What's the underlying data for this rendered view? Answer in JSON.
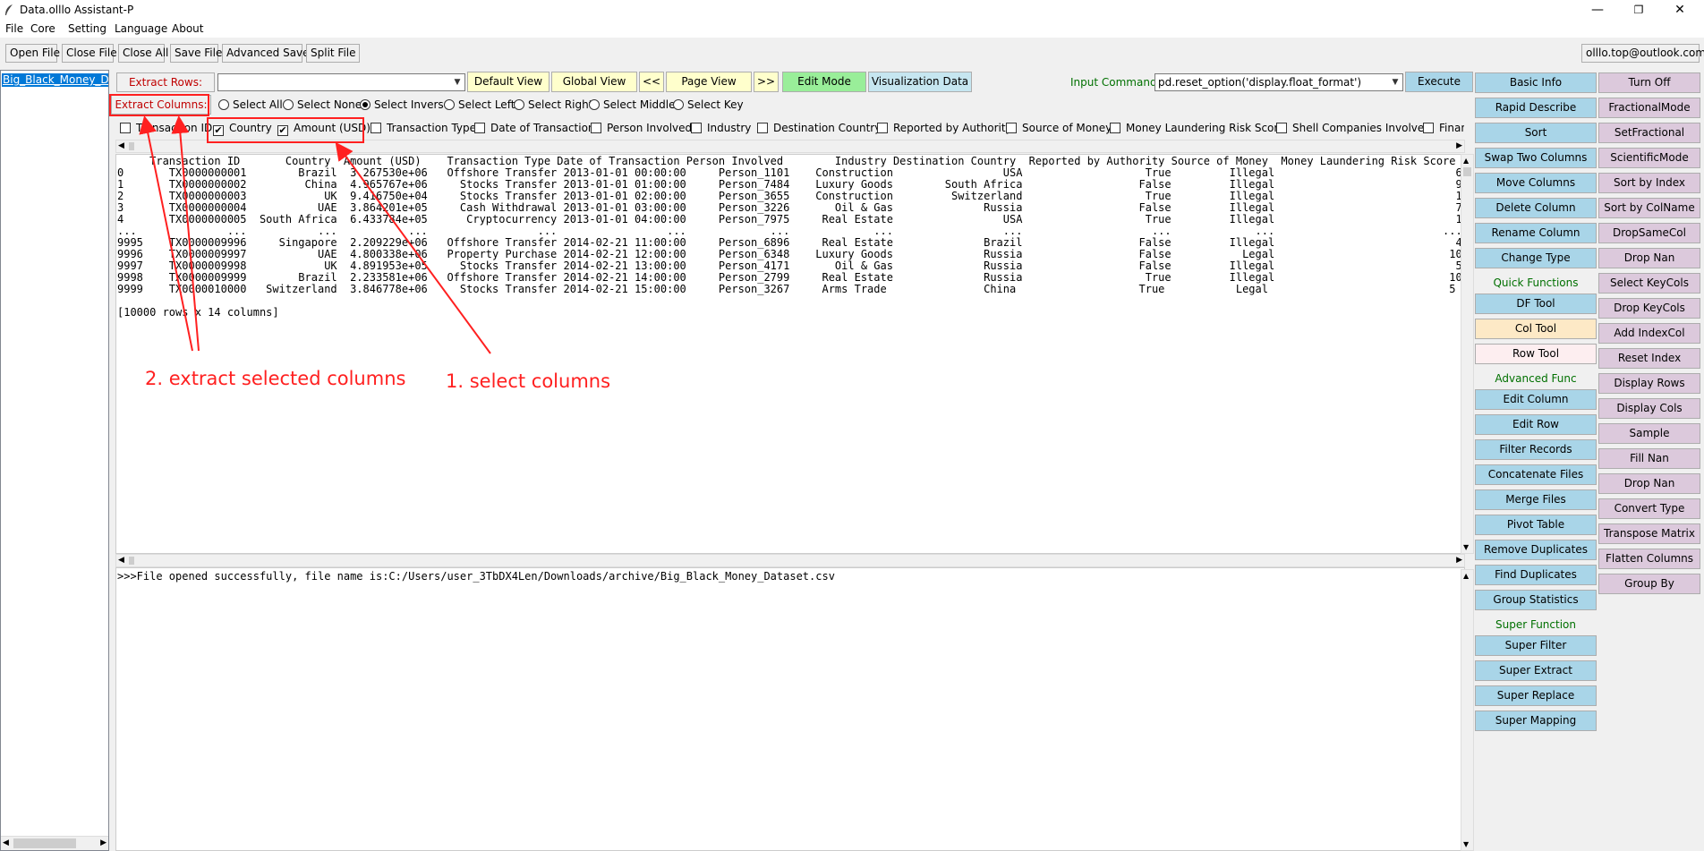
{
  "window": {
    "title": "Data.olllo Assistant-P",
    "minimize": "—",
    "maximize": "❐",
    "close": "✕"
  },
  "menu": [
    "File",
    "Core",
    "Setting",
    "Language",
    "About"
  ],
  "toolbar": {
    "buttons": [
      "Open File",
      "Close File",
      "Close All",
      "Save File",
      "Advanced Save",
      "Split File"
    ],
    "email": "olllo.top@outlook.com"
  },
  "file_list": {
    "items": [
      "Big_Black_Money_Dataset"
    ]
  },
  "controls": {
    "extract_rows_label": "Extract Rows:",
    "extract_rows_value": "",
    "extract_columns_label": "Extract Columns:",
    "view_buttons": [
      "Default View",
      "Global View",
      "<<",
      "Page View",
      ">>",
      "Edit Mode",
      "Visualization Data"
    ],
    "input_command_label": "Input Command:",
    "input_command_value": "pd.reset_option('display.float_format')",
    "execute_label": "Execute",
    "radios": [
      {
        "label": "Select All",
        "checked": false
      },
      {
        "label": "Select None",
        "checked": false
      },
      {
        "label": "Select Inverse",
        "checked": true
      },
      {
        "label": "Select Left",
        "checked": false
      },
      {
        "label": "Select Right",
        "checked": false
      },
      {
        "label": "Select Middle",
        "checked": false
      },
      {
        "label": "Select Key",
        "checked": false
      }
    ],
    "columns": [
      {
        "label": "Transaction ID",
        "checked": false
      },
      {
        "label": "Country",
        "checked": true
      },
      {
        "label": "Amount (USD)",
        "checked": true
      },
      {
        "label": "Transaction Type",
        "checked": false
      },
      {
        "label": "Date of Transaction",
        "checked": false
      },
      {
        "label": "Person Involved",
        "checked": false
      },
      {
        "label": "Industry",
        "checked": false
      },
      {
        "label": "Destination Country",
        "checked": false
      },
      {
        "label": "Reported by Authority",
        "checked": false
      },
      {
        "label": "Source of Money",
        "checked": false
      },
      {
        "label": "Money Laundering Risk Score",
        "checked": false
      },
      {
        "label": "Shell Companies Involved",
        "checked": false
      },
      {
        "label": "Financia",
        "checked": false
      }
    ]
  },
  "table": {
    "header": "     Transaction ID       Country  Amount (USD)    Transaction Type Date of Transaction Person Involved        Industry Destination Country  Reported by Authority Source of Money  Money Laundering Risk Score  Shell Co",
    "rows": [
      "0       TX0000000001        Brazil  3.267530e+06   Offshore Transfer 2013-01-01 00:00:00     Person_1101    Construction                 USA                   True         Illegal                            6",
      "1       TX0000000002         China  4.965767e+06     Stocks Transfer 2013-01-01 01:00:00     Person_7484    Luxury Goods        South Africa                  False         Illegal                            9",
      "2       TX0000000003            UK  9.416750e+04     Stocks Transfer 2013-01-01 02:00:00     Person_3655    Construction         Switzerland                   True         Illegal                            1",
      "3       TX0000000004           UAE  3.864201e+05     Cash Withdrawal 2013-01-01 03:00:00     Person_3226       Oil & Gas              Russia                  False         Illegal                            7",
      "4       TX0000000005  South Africa  6.433784e+05      Cryptocurrency 2013-01-01 04:00:00     Person_7975     Real Estate                 USA                   True         Illegal                            1",
      "...              ...           ...           ...                 ...                 ...             ...             ...                 ...                    ...             ...                          ...",
      "9995    TX0000009996     Singapore  2.209229e+06   Offshore Transfer 2014-02-21 11:00:00     Person_6896     Real Estate              Brazil                  False         Illegal                            4",
      "9996    TX0000009997           UAE  4.800338e+06   Property Purchase 2014-02-21 12:00:00     Person_6348    Luxury Goods              Russia                  False           Legal                           10",
      "9997    TX0000009998            UK  4.891953e+05     Stocks Transfer 2014-02-21 13:00:00     Person_4171       Oil & Gas              Russia                  False         Illegal                            5",
      "9998    TX0000009999        Brazil  2.233581e+06   Offshore Transfer 2014-02-21 14:00:00     Person_2799     Real Estate              Russia                   True         Illegal                           10",
      "9999    TX0000010000   Switzerland  3.846778e+06     Stocks Transfer 2014-02-21 15:00:00     Person_3267     Arms Trade               China                   True           Legal                            5"
    ],
    "summary": "[10000 rows x 14 columns]"
  },
  "log": {
    "text": ">>>File opened successfully, file name is:C:/Users/user_3TbDX4Len/Downloads/archive/Big_Black_Money_Dataset.csv"
  },
  "functions": {
    "col1": [
      {
        "label": "Basic Info",
        "type": "button"
      },
      {
        "label": "Rapid Describe",
        "type": "button"
      },
      {
        "label": "Sort",
        "type": "button"
      },
      {
        "label": "Swap Two Columns",
        "type": "button"
      },
      {
        "label": "Move Columns",
        "type": "button"
      },
      {
        "label": "Delete Column",
        "type": "button"
      },
      {
        "label": "Rename Column",
        "type": "button"
      },
      {
        "label": "Change Type",
        "type": "button"
      },
      {
        "label": "Quick Functions",
        "type": "section"
      },
      {
        "label": "DF Tool",
        "type": "button"
      },
      {
        "label": "Col Tool",
        "type": "button"
      },
      {
        "label": "Row Tool",
        "type": "button"
      },
      {
        "label": "Advanced Func",
        "type": "section"
      },
      {
        "label": "Edit Column",
        "type": "button"
      },
      {
        "label": "Edit Row",
        "type": "button"
      },
      {
        "label": "Filter Records",
        "type": "button"
      },
      {
        "label": "Concatenate Files",
        "type": "button"
      },
      {
        "label": "Merge Files",
        "type": "button"
      },
      {
        "label": "Pivot Table",
        "type": "button"
      },
      {
        "label": "Remove Duplicates",
        "type": "button"
      },
      {
        "label": "Find Duplicates",
        "type": "button"
      },
      {
        "label": "Group Statistics",
        "type": "button"
      },
      {
        "label": "Super Function",
        "type": "section"
      },
      {
        "label": "Super Filter",
        "type": "button"
      },
      {
        "label": "Super Extract",
        "type": "button"
      },
      {
        "label": "Super Replace",
        "type": "button"
      },
      {
        "label": "Super Mapping",
        "type": "button"
      }
    ],
    "col2": [
      "Turn Off",
      "FractionalMode",
      "SetFractional",
      "ScientificMode",
      "Sort by Index",
      "Sort by ColName",
      "DropSameCol",
      "Drop Nan",
      "Select KeyCols",
      "Drop KeyCols",
      "Add IndexCol",
      "Reset Index",
      "Display Rows",
      "Display Cols",
      "Sample",
      "Fill Nan",
      "Drop Nan",
      "Convert Type",
      "Transpose Matrix",
      "Flatten Columns",
      "Group By"
    ]
  },
  "annotations": {
    "step1": "1. select columns",
    "step2": "2. extract selected columns",
    "color": "#ff2020"
  }
}
